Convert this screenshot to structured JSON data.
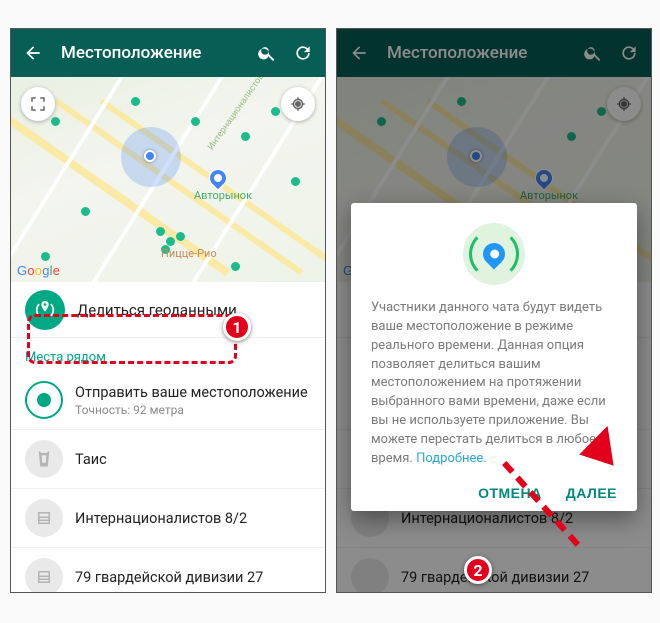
{
  "appbar": {
    "title": "Местоположение"
  },
  "map": {
    "poi1": "Авторынок",
    "poi2": "Пицце-Рио",
    "street": "Интернационалистов",
    "logo": "Google"
  },
  "share_chip": {
    "label": "Делиться геоданными"
  },
  "section": {
    "nearby": "Места рядом"
  },
  "list": {
    "send_current": {
      "title": "Отправить ваше местоположение",
      "subtitle": "Точность: 92 метра"
    },
    "place1": {
      "title": "Таис"
    },
    "place2": {
      "title": "Интернационалистов 8/2"
    },
    "place3": {
      "title": "79 гвардейской дивизии 27"
    }
  },
  "dialog": {
    "body": "Участники данного чата будут видеть ваше местоположение в режиме реального времени. Данная опция позволяет делиться вашим местоположением на протяжении выбранного вами времени, даже если вы не используете приложение. Вы можете перестать делиться в любое время.",
    "more": "Подробнее.",
    "cancel": "ОТМЕНА",
    "next": "ДАЛЕЕ"
  },
  "annotations": {
    "step1": "1",
    "step2": "2"
  }
}
